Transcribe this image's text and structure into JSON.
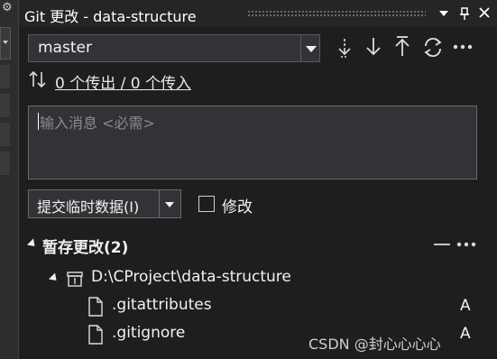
{
  "window": {
    "title": "Git 更改 - data-structure"
  },
  "toolbar": {
    "branch": "master",
    "icons": [
      "fetch-icon",
      "pull-icon",
      "push-icon",
      "sync-icon",
      "more-icon"
    ]
  },
  "sync": {
    "link_text": "0 个传出 / 0 个传入"
  },
  "commit": {
    "message_placeholder": "输入消息 <必需>",
    "button_label": "提交临时数据(I)",
    "amend_label": "修改",
    "amend_checked": false
  },
  "staged": {
    "header": "暂存更改(2)",
    "repo_path": "D:\\CProject\\data-structure",
    "files": [
      {
        "name": ".gitattributes",
        "status": "A"
      },
      {
        "name": ".gitignore",
        "status": "A"
      }
    ]
  },
  "watermark": "CSDN @封心心心心",
  "colors": {
    "background": "#1e1e1e",
    "titlebar": "#252526",
    "input": "#333337",
    "border": "#5a5a5a",
    "text": "#f1f1f1"
  }
}
